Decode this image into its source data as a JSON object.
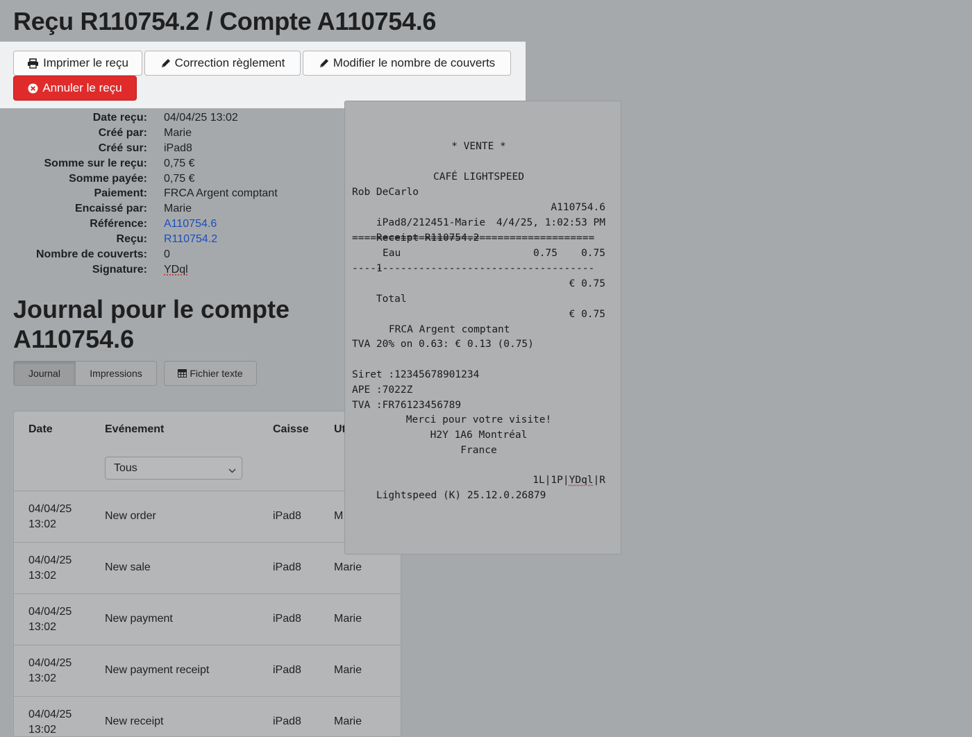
{
  "page": {
    "title": "Reçu R110754.2 / Compte A110754.6"
  },
  "toolbar": {
    "print_label": "Imprimer le reçu",
    "correction_label": "Correction règlement",
    "covers_label": "Modifier le nombre de couverts",
    "cancel_label": "Annuler le reçu",
    "cancel_color": "#e02b2b"
  },
  "details": [
    {
      "label": "Date reçu:",
      "value": "04/04/25 13:02"
    },
    {
      "label": "Créé par:",
      "value": "Marie"
    },
    {
      "label": "Créé sur:",
      "value": "iPad8"
    },
    {
      "label": "Somme sur le reçu:",
      "value": "0,75 €"
    },
    {
      "label": "Somme payée:",
      "value": "0,75 €"
    },
    {
      "label": "Paiement:",
      "value": "FRCA Argent comptant"
    },
    {
      "label": "Encaissé par:",
      "value": "Marie"
    },
    {
      "label": "Référence:",
      "value": "A110754.6",
      "link": true
    },
    {
      "label": "Reçu:",
      "value": "R110754.2",
      "link": true
    },
    {
      "label": "Nombre de couverts:",
      "value": "0"
    },
    {
      "label": "Signature:",
      "value": "YDql",
      "signature": true
    }
  ],
  "journal": {
    "title": "Journal pour le compte A110754.6",
    "tabs": [
      "Journal",
      "Impressions"
    ],
    "active_tab": "Journal",
    "export_label": "Fichier texte",
    "columns": {
      "date": "Date",
      "event": "Evénement",
      "register": "Caisse",
      "user": "Ut"
    },
    "filter_value": "Tous",
    "rows": [
      {
        "date": "04/04/25",
        "time": "13:02",
        "event": "New order",
        "register": "iPad8",
        "user": "M"
      },
      {
        "date": "04/04/25",
        "time": "13:02",
        "event": "New sale",
        "register": "iPad8",
        "user": "Marie"
      },
      {
        "date": "04/04/25",
        "time": "13:02",
        "event": "New payment",
        "register": "iPad8",
        "user": "Marie"
      },
      {
        "date": "04/04/25",
        "time": "13:02",
        "event": "New payment receipt",
        "register": "iPad8",
        "user": "Marie"
      },
      {
        "date": "04/04/25",
        "time": "13:02",
        "event": "New receipt",
        "register": "iPad8",
        "user": "Marie"
      }
    ]
  },
  "receipt": {
    "heading": "* VENTE *",
    "shop": "CAFÉ LIGHTSPEED",
    "server": "Rob DeCarlo",
    "device_line": "iPad8/212451-Marie",
    "account": "A110754.6",
    "receipt_line": "Receipt R110754.2",
    "timestamp": "4/4/25, 1:02:53 PM",
    "separator_double": "========================================",
    "separator_single": "----------------------------------------",
    "item_qty": "1",
    "item_name": "Eau",
    "item_unit": "0.75",
    "item_total": "0.75",
    "total_label": "Total",
    "total_value": "€ 0.75",
    "payment_label": "FRCA Argent comptant",
    "payment_value": "€ 0.75",
    "vat_line": "TVA 20% on 0.63: € 0.13 (0.75)",
    "siret": "Siret :12345678901234",
    "ape": "APE :7022Z",
    "tva": "TVA :FR76123456789",
    "thanks": "Merci pour votre visite!",
    "postal": "H2Y 1A6 Montréal",
    "country": "France",
    "footer_left": "Lightspeed (K) 25.12.0.26879",
    "footer_right_prefix": "1L|1P|",
    "footer_right_sig": "YDql",
    "footer_right_suffix": "|R"
  }
}
